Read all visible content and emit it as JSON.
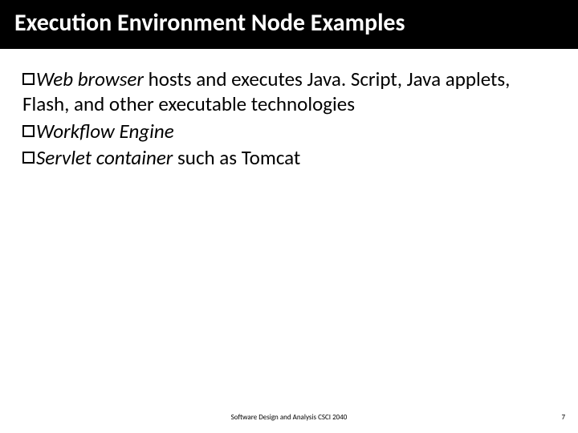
{
  "title": "Execution Environment Node Examples",
  "bullets": [
    {
      "lead_italic": "Web browser",
      "rest": " hosts and executes Java. Script, Java applets, Flash, and other executable technologies"
    },
    {
      "lead_italic": "Workflow Engine",
      "rest": ""
    },
    {
      "lead_italic": "Servlet container",
      "rest": " such as Tomcat"
    }
  ],
  "footer": "Software Design and Analysis CSCI 2040",
  "page_number": "7"
}
